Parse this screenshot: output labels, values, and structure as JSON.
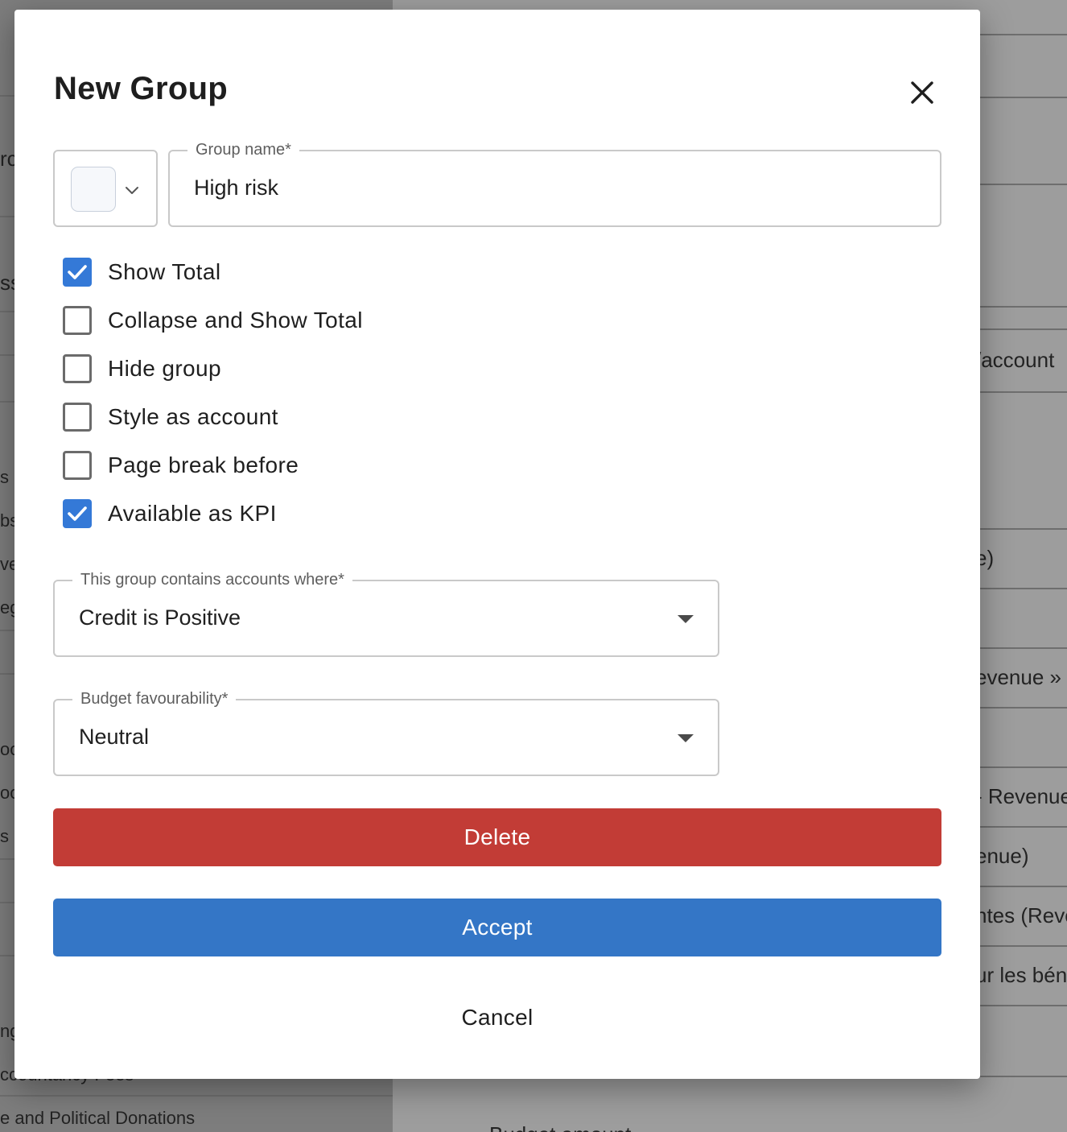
{
  "background": {
    "left_texts": [
      "rc",
      "ss",
      "s",
      "bs",
      "ve",
      "eg",
      "oo",
      "oo",
      "s",
      "ng",
      "ccountancy Fees",
      "e and Political Donations"
    ],
    "right_texts": [
      "/account",
      "e)",
      "evenue »",
      "- Revenue",
      "enue)",
      "ntes (Reve",
      "ur les bén",
      "Budget amount"
    ]
  },
  "dialog": {
    "title": "New Group",
    "close_icon": "close-icon",
    "color_picker": {
      "swatch_color": "#f6f8fb",
      "icon": "chevron-down-icon"
    },
    "group_name": {
      "label": "Group name*",
      "value": "High risk"
    },
    "checkboxes": [
      {
        "label": "Show Total",
        "checked": true
      },
      {
        "label": "Collapse and Show Total",
        "checked": false
      },
      {
        "label": "Hide group",
        "checked": false
      },
      {
        "label": "Style as account",
        "checked": false
      },
      {
        "label": "Page break before",
        "checked": false
      },
      {
        "label": "Available as KPI",
        "checked": true
      }
    ],
    "contains": {
      "label": "This group contains accounts where*",
      "value": "Credit is Positive"
    },
    "favourability": {
      "label": "Budget favourability*",
      "value": "Neutral"
    },
    "buttons": {
      "delete": "Delete",
      "accept": "Accept",
      "cancel": "Cancel"
    }
  },
  "colors": {
    "primary": "#3476c6",
    "danger": "#c23c36",
    "checkbox": "#3479d7"
  }
}
